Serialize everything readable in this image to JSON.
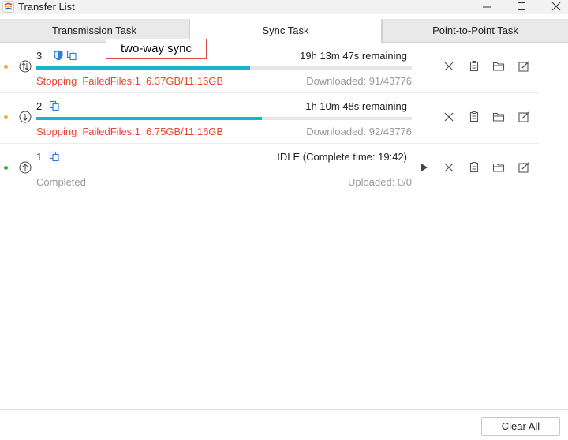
{
  "window": {
    "title": "Transfer List",
    "controls": [
      "minimize-icon",
      "maximize-icon",
      "close-icon"
    ]
  },
  "tabs": [
    {
      "label": "Transmission Task",
      "active": false
    },
    {
      "label": "Sync Task",
      "active": true
    },
    {
      "label": "Point-to-Point Task",
      "active": false
    }
  ],
  "annotation": {
    "text": "two-way sync"
  },
  "tasks": [
    {
      "number": "3",
      "status_dot_color": "#f5a623",
      "direction_icon": "two-way-sync-icon",
      "badges": [
        "shield-icon",
        "copy-icon"
      ],
      "remaining": "19h 13m 47s remaining",
      "progress": 0.57,
      "status": "Stopping",
      "failed": "FailedFiles:1",
      "size": "6.37GB/11.16GB",
      "counter": "Downloaded: 91/43776",
      "actions": [
        "cancel-icon",
        "clipboard-icon",
        "folder-icon",
        "edit-icon"
      ]
    },
    {
      "number": "2",
      "status_dot_color": "#f5a623",
      "direction_icon": "download-icon",
      "badges": [
        "copy-icon"
      ],
      "remaining": "1h 10m 48s remaining",
      "progress": 0.6,
      "status": "Stopping",
      "failed": "FailedFiles:1",
      "size": "6.75GB/11.16GB",
      "counter": "Downloaded: 92/43776",
      "actions": [
        "cancel-icon",
        "clipboard-icon",
        "folder-icon",
        "edit-icon"
      ]
    },
    {
      "number": "1",
      "status_dot_color": "#3cb043",
      "direction_icon": "upload-icon",
      "badges": [
        "copy-icon"
      ],
      "remaining": "IDLE (Complete time: 19:42)",
      "status_text": "Completed",
      "counter": "Uploaded: 0/0",
      "actions": [
        "play-icon",
        "cancel-icon",
        "clipboard-icon",
        "folder-icon",
        "edit-icon"
      ]
    }
  ],
  "footer": {
    "clear_all_label": "Clear All"
  },
  "colors": {
    "accent": "#1bb3cc",
    "error": "#e8452e",
    "muted": "#999999"
  }
}
